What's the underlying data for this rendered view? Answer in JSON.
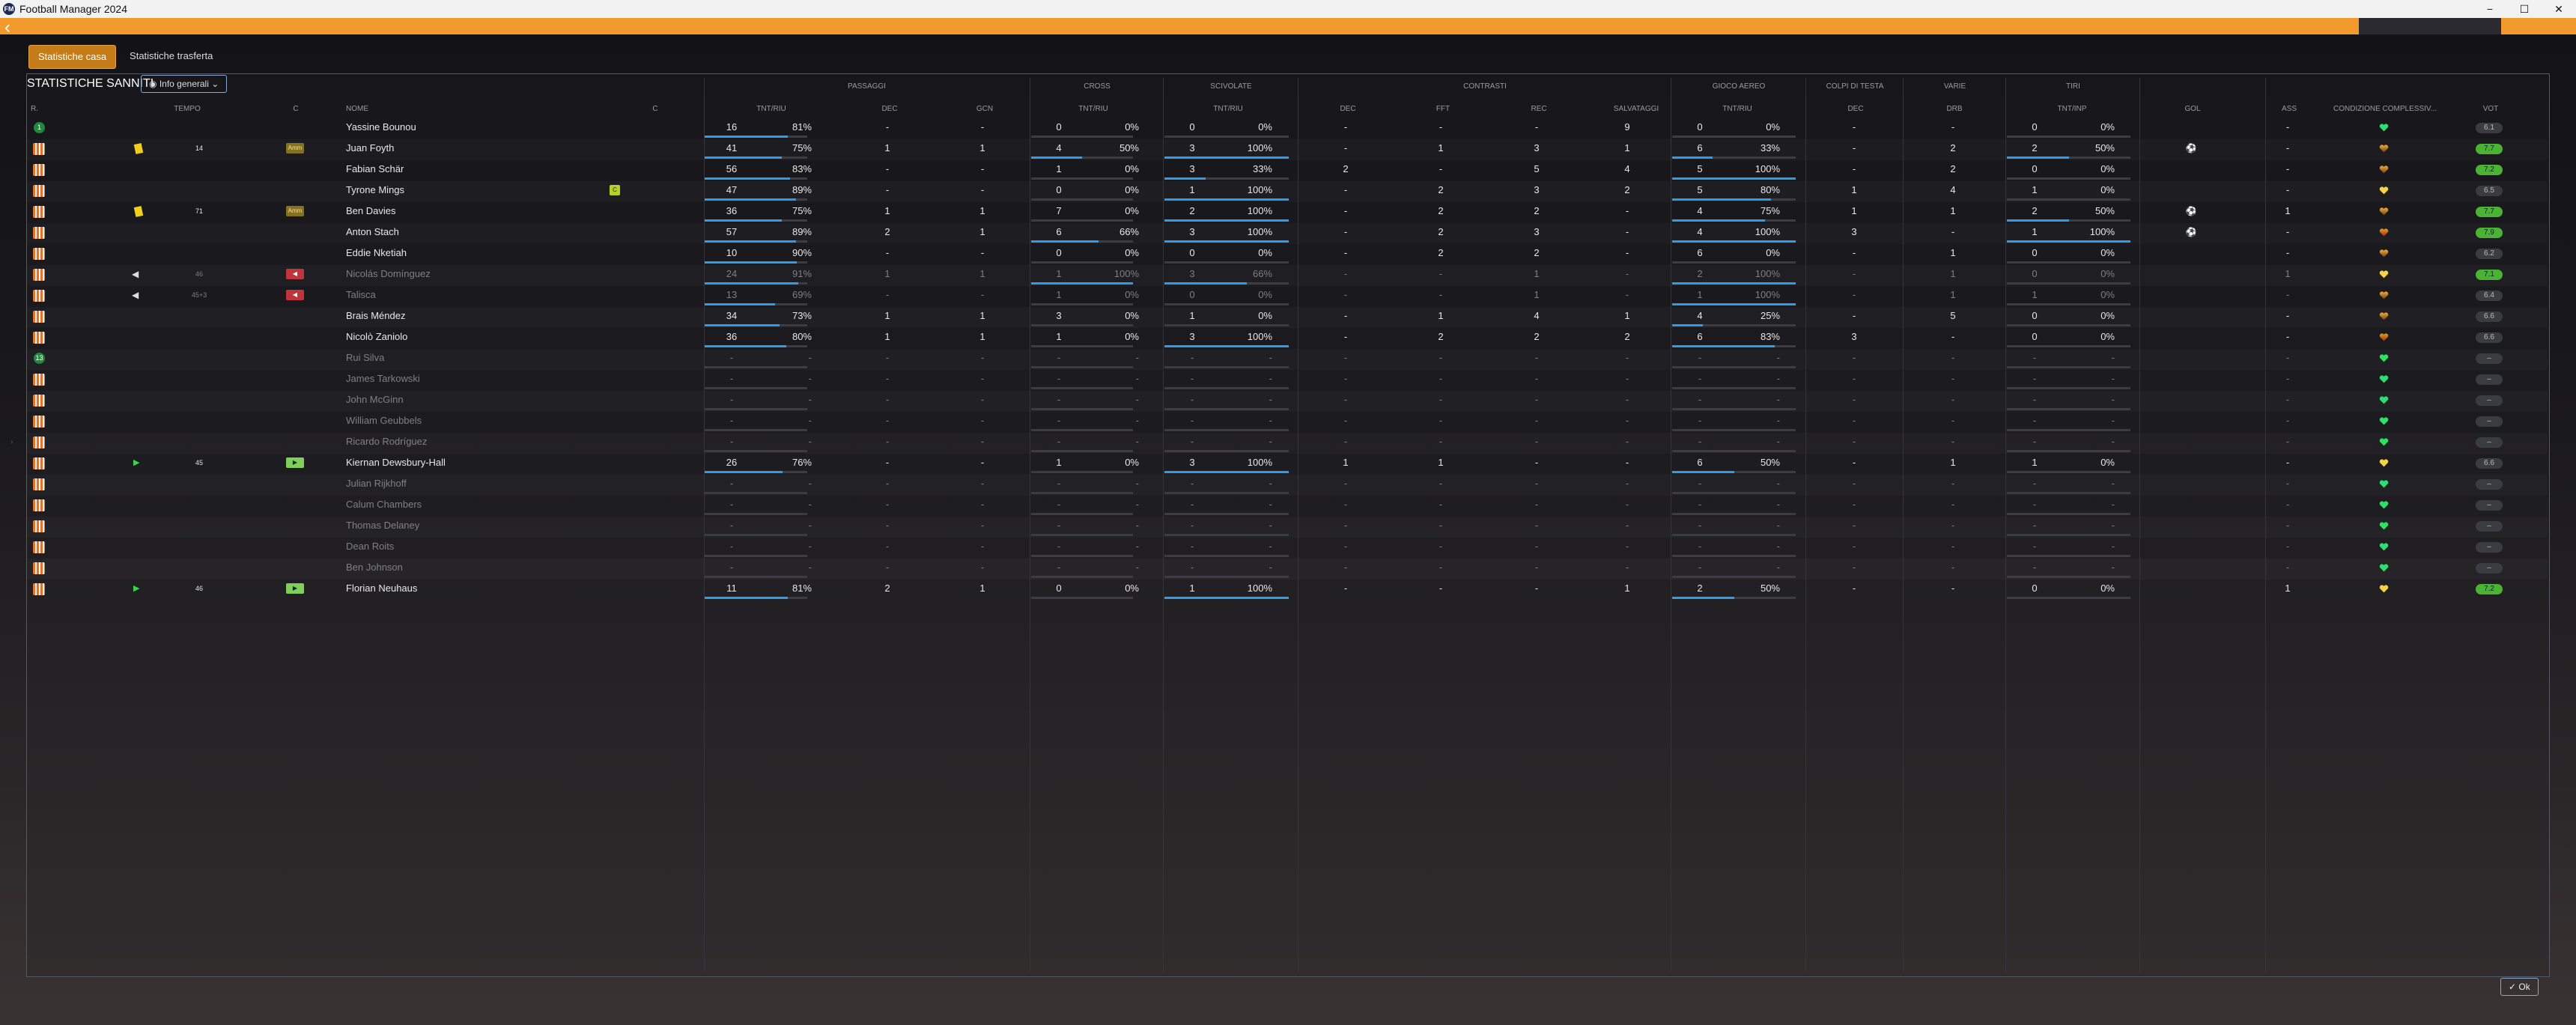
{
  "window": {
    "title": "Football Manager 2024",
    "min": "−",
    "max": "☐",
    "close": "✕"
  },
  "tabs": [
    {
      "label": "Statistiche casa",
      "active": true
    },
    {
      "label": "Statistiche trasferta",
      "active": false
    }
  ],
  "section_title": "STATISTICHE SANNITI",
  "info_button": "Info generali",
  "ok_button": "Ok",
  "group_headers": [
    "PASSAGGI",
    "CROSS",
    "SCIVOLATE",
    "CONTRASTI",
    "GIOCO AEREO",
    "COLPI DI TESTA",
    "VARIE",
    "TIRI"
  ],
  "column_headers": {
    "pos": "R.",
    "tempo": "TEMPO",
    "c": "C",
    "nome": "NOME",
    "c2": "C",
    "pass_tnt": "TNT/RIU",
    "pass_dec": "DEC",
    "pass_gcn": "GCN",
    "cross_tnt": "TNT/RIU",
    "sciv_tnt": "TNT/RIU",
    "contr_dec": "DEC",
    "contr_fft": "FFT",
    "contr_rec": "REC",
    "contr_salv": "SALVATAGGI",
    "aereo_tnt": "TNT/RIU",
    "testa_dec": "DEC",
    "varie_drb": "DRB",
    "tiri_tnt": "TNT/INP",
    "gol": "GOL",
    "ass": "ASS",
    "cond": "CONDIZIONE COMPLESSIV...",
    "vot": "VOT"
  },
  "players": [
    {
      "icon": "gk",
      "gk_num": "1",
      "card": "",
      "tempo": "",
      "cbadge": "",
      "name": "Yassine Bounou",
      "dim": false,
      "c2": "",
      "pass": [
        "16",
        "81%"
      ],
      "pass_pct": 81,
      "pdec": "-",
      "pgcn": "-",
      "cross": [
        "0",
        "0%"
      ],
      "cross_pct": 0,
      "sciv": [
        "0",
        "0%"
      ],
      "sciv_pct": 0,
      "cdec": "-",
      "fft": "-",
      "rec": "-",
      "salv": "9",
      "aereo": [
        "0",
        "0%"
      ],
      "aereo_pct": 0,
      "tdec": "-",
      "drb": "-",
      "tiri": [
        "0",
        "0%"
      ],
      "tiri_pct": 0,
      "gol": "",
      "ass": "-",
      "heart": "green",
      "vot": "6.1",
      "vot_type": "avg"
    },
    {
      "icon": "shirt",
      "card": "yellow",
      "tempo": "14",
      "cbadge": "yc",
      "cbadge_text": "Amm",
      "name": "Juan Foyth",
      "dim": false,
      "c2": "",
      "pass": [
        "41",
        "75%"
      ],
      "pass_pct": 75,
      "pdec": "1",
      "pgcn": "1",
      "cross": [
        "4",
        "50%"
      ],
      "cross_pct": 50,
      "sciv": [
        "3",
        "100%"
      ],
      "sciv_pct": 100,
      "cdec": "-",
      "fft": "1",
      "rec": "3",
      "salv": "1",
      "aereo": [
        "6",
        "33%"
      ],
      "aereo_pct": 33,
      "tdec": "-",
      "drb": "2",
      "tiri": [
        "2",
        "50%"
      ],
      "tiri_pct": 50,
      "gol": "ball",
      "ass": "-",
      "heart": "half",
      "vot": "7.7",
      "vot_type": "good"
    },
    {
      "icon": "shirt",
      "card": "",
      "tempo": "",
      "cbadge": "",
      "name": "Fabian Schär",
      "dim": false,
      "c2": "",
      "pass": [
        "56",
        "83%"
      ],
      "pass_pct": 83,
      "pdec": "-",
      "pgcn": "-",
      "cross": [
        "1",
        "0%"
      ],
      "cross_pct": 0,
      "sciv": [
        "3",
        "33%"
      ],
      "sciv_pct": 33,
      "cdec": "2",
      "fft": "-",
      "rec": "5",
      "salv": "4",
      "aereo": [
        "5",
        "100%"
      ],
      "aereo_pct": 100,
      "tdec": "-",
      "drb": "2",
      "tiri": [
        "0",
        "0%"
      ],
      "tiri_pct": 0,
      "gol": "",
      "ass": "-",
      "heart": "half",
      "vot": "7.2",
      "vot_type": "good"
    },
    {
      "icon": "shirt",
      "card": "",
      "tempo": "",
      "cbadge": "",
      "name": "Tyrone Mings",
      "dim": false,
      "c2": "badge",
      "pass": [
        "47",
        "89%"
      ],
      "pass_pct": 89,
      "pdec": "-",
      "pgcn": "-",
      "cross": [
        "0",
        "0%"
      ],
      "cross_pct": 0,
      "sciv": [
        "1",
        "100%"
      ],
      "sciv_pct": 100,
      "cdec": "-",
      "fft": "2",
      "rec": "3",
      "salv": "2",
      "aereo": [
        "5",
        "80%"
      ],
      "aereo_pct": 80,
      "tdec": "1",
      "drb": "4",
      "tiri": [
        "1",
        "0%"
      ],
      "tiri_pct": 0,
      "gol": "",
      "ass": "-",
      "heart": "yellow",
      "vot": "6.5",
      "vot_type": "avg"
    },
    {
      "icon": "shirt",
      "card": "yellow",
      "tempo": "71",
      "cbadge": "yc",
      "cbadge_text": "Amm",
      "name": "Ben Davies",
      "dim": false,
      "c2": "",
      "pass": [
        "36",
        "75%"
      ],
      "pass_pct": 75,
      "pdec": "1",
      "pgcn": "1",
      "cross": [
        "7",
        "0%"
      ],
      "cross_pct": 0,
      "sciv": [
        "2",
        "100%"
      ],
      "sciv_pct": 100,
      "cdec": "-",
      "fft": "2",
      "rec": "2",
      "salv": "-",
      "aereo": [
        "4",
        "75%"
      ],
      "aereo_pct": 75,
      "tdec": "1",
      "drb": "1",
      "tiri": [
        "2",
        "50%"
      ],
      "tiri_pct": 50,
      "gol": "ball",
      "ass": "1",
      "heart": "half",
      "vot": "7.7",
      "vot_type": "good"
    },
    {
      "icon": "shirt",
      "card": "",
      "tempo": "",
      "cbadge": "",
      "name": "Anton Stach",
      "dim": false,
      "c2": "",
      "pass": [
        "57",
        "89%"
      ],
      "pass_pct": 89,
      "pdec": "2",
      "pgcn": "1",
      "cross": [
        "6",
        "66%"
      ],
      "cross_pct": 66,
      "sciv": [
        "3",
        "100%"
      ],
      "sciv_pct": 100,
      "cdec": "-",
      "fft": "2",
      "rec": "3",
      "salv": "-",
      "aereo": [
        "4",
        "100%"
      ],
      "aereo_pct": 100,
      "tdec": "3",
      "drb": "-",
      "tiri": [
        "1",
        "100%"
      ],
      "tiri_pct": 100,
      "gol": "ball",
      "ass": "-",
      "heart": "low",
      "vot": "7.9",
      "vot_type": "good"
    },
    {
      "icon": "shirt",
      "card": "",
      "tempo": "",
      "cbadge": "",
      "name": "Eddie Nketiah",
      "dim": false,
      "c2": "",
      "pass": [
        "10",
        "90%"
      ],
      "pass_pct": 90,
      "pdec": "-",
      "pgcn": "-",
      "cross": [
        "0",
        "0%"
      ],
      "cross_pct": 0,
      "sciv": [
        "0",
        "0%"
      ],
      "sciv_pct": 0,
      "cdec": "-",
      "fft": "2",
      "rec": "2",
      "salv": "-",
      "aereo": [
        "6",
        "0%"
      ],
      "aereo_pct": 0,
      "tdec": "-",
      "drb": "1",
      "tiri": [
        "0",
        "0%"
      ],
      "tiri_pct": 0,
      "gol": "",
      "ass": "-",
      "heart": "half",
      "vot": "6.2",
      "vot_type": "avg"
    },
    {
      "icon": "shirt",
      "card": "subout",
      "tempo": "46",
      "cbadge": "red",
      "cbadge_text": "◀",
      "name": "Nicolás Domínguez",
      "dim": true,
      "c2": "",
      "pass": [
        "24",
        "91%"
      ],
      "pass_pct": 91,
      "pdec": "1",
      "pgcn": "1",
      "cross": [
        "1",
        "100%"
      ],
      "cross_pct": 100,
      "sciv": [
        "3",
        "66%"
      ],
      "sciv_pct": 66,
      "cdec": "-",
      "fft": "-",
      "rec": "1",
      "salv": "-",
      "aereo": [
        "2",
        "100%"
      ],
      "aereo_pct": 100,
      "tdec": "-",
      "drb": "1",
      "tiri": [
        "0",
        "0%"
      ],
      "tiri_pct": 0,
      "gol": "",
      "ass": "1",
      "heart": "yellow",
      "vot": "7.1",
      "vot_type": "good"
    },
    {
      "icon": "shirt",
      "card": "subout",
      "tempo": "45+3",
      "cbadge": "red",
      "cbadge_text": "◀",
      "name": "Talisca",
      "dim": true,
      "c2": "",
      "pass": [
        "13",
        "69%"
      ],
      "pass_pct": 69,
      "pdec": "-",
      "pgcn": "-",
      "cross": [
        "1",
        "0%"
      ],
      "cross_pct": 0,
      "sciv": [
        "0",
        "0%"
      ],
      "sciv_pct": 0,
      "cdec": "-",
      "fft": "-",
      "rec": "1",
      "salv": "-",
      "aereo": [
        "1",
        "100%"
      ],
      "aereo_pct": 100,
      "tdec": "-",
      "drb": "1",
      "tiri": [
        "1",
        "0%"
      ],
      "tiri_pct": 0,
      "gol": "",
      "ass": "-",
      "heart": "half",
      "vot": "6.4",
      "vot_type": "avg"
    },
    {
      "icon": "shirt",
      "card": "",
      "tempo": "",
      "cbadge": "",
      "name": "Brais Méndez",
      "dim": false,
      "c2": "",
      "pass": [
        "34",
        "73%"
      ],
      "pass_pct": 73,
      "pdec": "1",
      "pgcn": "1",
      "cross": [
        "3",
        "0%"
      ],
      "cross_pct": 0,
      "sciv": [
        "1",
        "0%"
      ],
      "sciv_pct": 0,
      "cdec": "-",
      "fft": "1",
      "rec": "4",
      "salv": "1",
      "aereo": [
        "4",
        "25%"
      ],
      "aereo_pct": 25,
      "tdec": "-",
      "drb": "5",
      "tiri": [
        "0",
        "0%"
      ],
      "tiri_pct": 0,
      "gol": "",
      "ass": "-",
      "heart": "half",
      "vot": "6.6",
      "vot_type": "avg"
    },
    {
      "icon": "shirt",
      "card": "",
      "tempo": "",
      "cbadge": "",
      "name": "Nicolò Zaniolo",
      "dim": false,
      "c2": "",
      "pass": [
        "36",
        "80%"
      ],
      "pass_pct": 80,
      "pdec": "1",
      "pgcn": "1",
      "cross": [
        "1",
        "0%"
      ],
      "cross_pct": 0,
      "sciv": [
        "3",
        "100%"
      ],
      "sciv_pct": 100,
      "cdec": "-",
      "fft": "2",
      "rec": "2",
      "salv": "2",
      "aereo": [
        "6",
        "83%"
      ],
      "aereo_pct": 83,
      "tdec": "3",
      "drb": "-",
      "tiri": [
        "0",
        "0%"
      ],
      "tiri_pct": 0,
      "gol": "",
      "ass": "-",
      "heart": "low",
      "vot": "6.6",
      "vot_type": "avg"
    },
    {
      "icon": "gk",
      "gk_num": "13",
      "card": "",
      "tempo": "",
      "cbadge": "",
      "name": "Rui Silva",
      "dim": true,
      "c2": "",
      "empty": true,
      "heart": "green",
      "vot": "–",
      "vot_type": "avg"
    },
    {
      "icon": "shirt",
      "card": "",
      "tempo": "",
      "cbadge": "",
      "name": "James Tarkowski",
      "dim": true,
      "c2": "",
      "empty": true,
      "heart": "green",
      "vot": "–",
      "vot_type": "avg"
    },
    {
      "icon": "shirt",
      "card": "",
      "tempo": "",
      "cbadge": "",
      "name": "John McGinn",
      "dim": true,
      "c2": "",
      "empty": true,
      "heart": "green",
      "vot": "–",
      "vot_type": "avg"
    },
    {
      "icon": "shirt",
      "card": "",
      "tempo": "",
      "cbadge": "",
      "name": "William Geubbels",
      "dim": true,
      "c2": "",
      "empty": true,
      "heart": "green",
      "vot": "–",
      "vot_type": "avg"
    },
    {
      "icon": "shirt",
      "card": "",
      "tempo": "",
      "cbadge": "",
      "name": "Ricardo Rodríguez",
      "dim": true,
      "c2": "",
      "empty": true,
      "heart": "green",
      "vot": "–",
      "vot_type": "avg"
    },
    {
      "icon": "shirt",
      "card": "subin",
      "tempo": "45",
      "cbadge": "green",
      "cbadge_text": "▶",
      "name": "Kiernan Dewsbury-Hall",
      "dim": false,
      "c2": "",
      "pass": [
        "26",
        "76%"
      ],
      "pass_pct": 76,
      "pdec": "-",
      "pgcn": "-",
      "cross": [
        "1",
        "0%"
      ],
      "cross_pct": 0,
      "sciv": [
        "3",
        "100%"
      ],
      "sciv_pct": 100,
      "cdec": "1",
      "fft": "1",
      "rec": "-",
      "salv": "-",
      "aereo": [
        "6",
        "50%"
      ],
      "aereo_pct": 50,
      "tdec": "-",
      "drb": "1",
      "tiri": [
        "1",
        "0%"
      ],
      "tiri_pct": 0,
      "gol": "",
      "ass": "-",
      "heart": "yellow",
      "vot": "6.6",
      "vot_type": "avg"
    },
    {
      "icon": "shirt",
      "card": "",
      "tempo": "",
      "cbadge": "",
      "name": "Julian Rijkhoff",
      "dim": true,
      "c2": "",
      "empty": true,
      "heart": "green",
      "vot": "–",
      "vot_type": "avg"
    },
    {
      "icon": "shirt",
      "card": "",
      "tempo": "",
      "cbadge": "",
      "name": "Calum Chambers",
      "dim": true,
      "c2": "",
      "empty": true,
      "heart": "green",
      "vot": "–",
      "vot_type": "avg"
    },
    {
      "icon": "shirt",
      "card": "",
      "tempo": "",
      "cbadge": "",
      "name": "Thomas Delaney",
      "dim": true,
      "c2": "",
      "empty": true,
      "heart": "green",
      "vot": "–",
      "vot_type": "avg"
    },
    {
      "icon": "shirt",
      "card": "",
      "tempo": "",
      "cbadge": "",
      "name": "Dean Roits",
      "dim": true,
      "c2": "",
      "empty": true,
      "heart": "green",
      "vot": "–",
      "vot_type": "avg"
    },
    {
      "icon": "shirt",
      "card": "",
      "tempo": "",
      "cbadge": "",
      "name": "Ben Johnson",
      "dim": true,
      "c2": "",
      "empty": true,
      "heart": "green",
      "vot": "–",
      "vot_type": "avg"
    },
    {
      "icon": "shirt",
      "card": "subin",
      "tempo": "46",
      "cbadge": "green",
      "cbadge_text": "▶",
      "name": "Florian Neuhaus",
      "dim": false,
      "c2": "",
      "pass": [
        "11",
        "81%"
      ],
      "pass_pct": 81,
      "pdec": "2",
      "pgcn": "1",
      "cross": [
        "0",
        "0%"
      ],
      "cross_pct": 0,
      "sciv": [
        "1",
        "100%"
      ],
      "sciv_pct": 100,
      "cdec": "-",
      "fft": "-",
      "rec": "-",
      "salv": "1",
      "aereo": [
        "2",
        "50%"
      ],
      "aereo_pct": 50,
      "tdec": "-",
      "drb": "-",
      "tiri": [
        "0",
        "0%"
      ],
      "tiri_pct": 0,
      "gol": "",
      "ass": "1",
      "heart": "yellow",
      "vot": "7.2",
      "vot_type": "good"
    }
  ],
  "colors": {
    "accent": "#f29a2e",
    "bar": "#2f9bea",
    "good_rating": "#4ab334",
    "tab_active": "#c47b18"
  }
}
